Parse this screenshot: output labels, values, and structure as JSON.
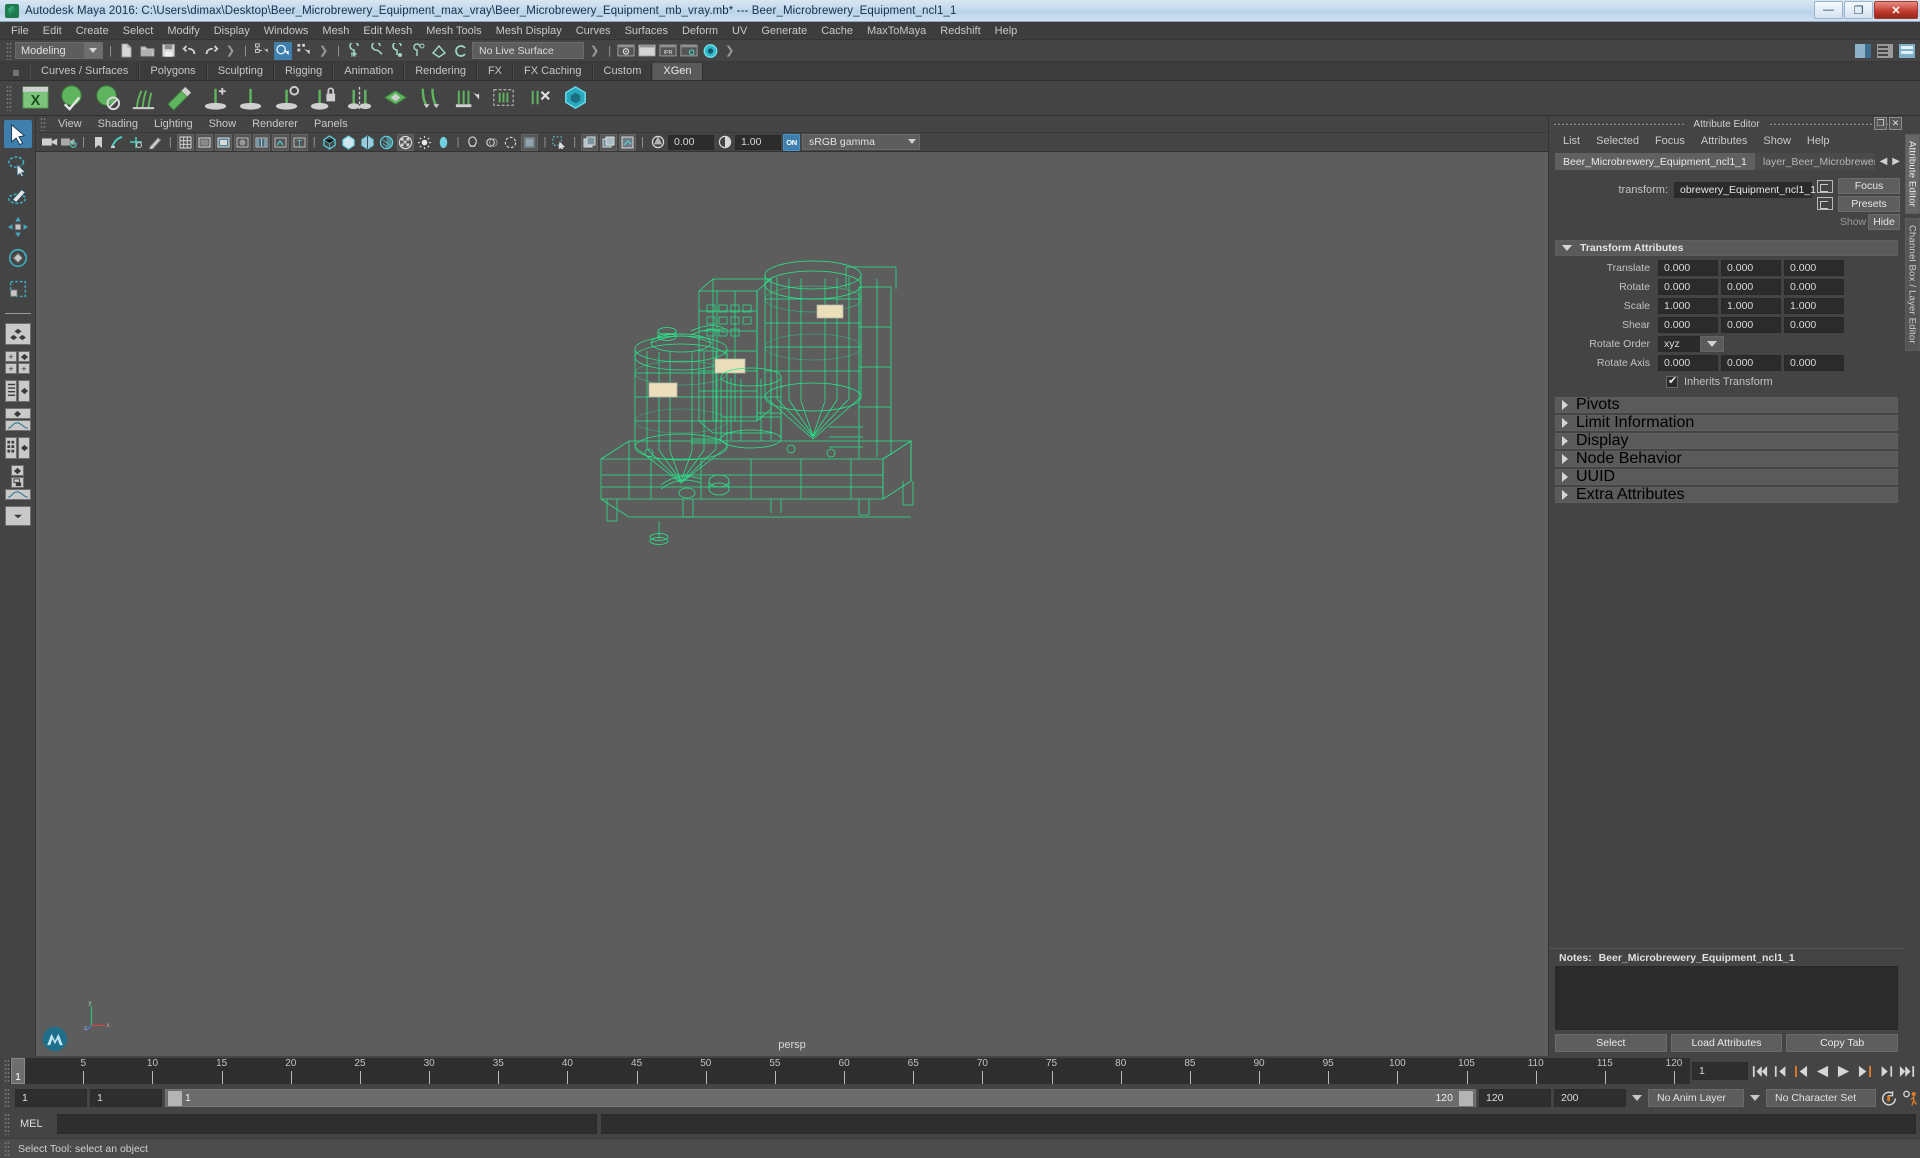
{
  "window": {
    "app_title": "Autodesk Maya 2016: C:\\Users\\dimax\\Desktop\\Beer_Microbrewery_Equipment_max_vray\\Beer_Microbrewery_Equipment_mb_vray.mb*   ---   Beer_Microbrewery_Equipment_ncl1_1",
    "minimize_label": "—",
    "restore_label": "❐",
    "close_label": "✕"
  },
  "main_menu": [
    "File",
    "Edit",
    "Create",
    "Select",
    "Modify",
    "Display",
    "Windows",
    "Mesh",
    "Edit Mesh",
    "Mesh Tools",
    "Mesh Display",
    "Curves",
    "Surfaces",
    "Deform",
    "UV",
    "Generate",
    "Cache",
    "MaxToMaya",
    "Redshift",
    "Help"
  ],
  "status_line": {
    "menuset": "Modeling",
    "live_surface": "No Live Surface"
  },
  "shelf": {
    "tabs": [
      "Curves / Surfaces",
      "Polygons",
      "Sculpting",
      "Rigging",
      "Animation",
      "Rendering",
      "FX",
      "FX Caching",
      "Custom",
      "XGen"
    ],
    "active_tab": "XGen"
  },
  "panel_menu": [
    "View",
    "Shading",
    "Lighting",
    "Show",
    "Renderer",
    "Panels"
  ],
  "viewport": {
    "exposure": "0.00",
    "gamma": "1.00",
    "view_transform": "sRGB gamma",
    "toggle_on_label": "ON",
    "camera_label": "persp",
    "axis_x": "x",
    "axis_y": "y",
    "axis_z": "z"
  },
  "attribute_editor": {
    "panel_title": "Attribute Editor",
    "menu": [
      "List",
      "Selected",
      "Focus",
      "Attributes",
      "Show",
      "Help"
    ],
    "tabs": [
      {
        "label": "Beer_Microbrewery_Equipment_ncl1_1",
        "active": true
      },
      {
        "label": "layer_Beer_Microbrewery_Equ",
        "active": false
      }
    ],
    "node_type_label": "transform:",
    "node_name": "obrewery_Equipment_ncl1_1",
    "focus_label": "Focus",
    "presets_label": "Presets",
    "show_label": "Show",
    "hide_label": "Hide",
    "transform_section": {
      "title": "Transform Attributes",
      "rows": [
        {
          "name": "Translate",
          "values": [
            "0.000",
            "0.000",
            "0.000"
          ]
        },
        {
          "name": "Rotate",
          "values": [
            "0.000",
            "0.000",
            "0.000"
          ]
        },
        {
          "name": "Scale",
          "values": [
            "1.000",
            "1.000",
            "1.000"
          ]
        },
        {
          "name": "Shear",
          "values": [
            "0.000",
            "0.000",
            "0.000"
          ]
        }
      ],
      "rotate_order_label": "Rotate Order",
      "rotate_order_value": "xyz",
      "rotate_axis": {
        "name": "Rotate Axis",
        "values": [
          "0.000",
          "0.000",
          "0.000"
        ]
      },
      "inherits_transform_label": "Inherits Transform",
      "inherits_transform_checked": true
    },
    "collapsed_sections": [
      "Pivots",
      "Limit Information",
      "Display",
      "Node Behavior",
      "UUID",
      "Extra Attributes"
    ],
    "notes_label": "Notes:",
    "notes_node": "Beer_Microbrewery_Equipment_ncl1_1",
    "notes_value": "",
    "buttons": [
      "Select",
      "Load Attributes",
      "Copy Tab"
    ],
    "vertical_tabs": [
      "Attribute Editor",
      "Channel Box / Layer Editor"
    ]
  },
  "timeline": {
    "start": 1,
    "end": 120,
    "current_frame": "1",
    "tick_labels": [
      5,
      10,
      15,
      20,
      25,
      30,
      35,
      40,
      45,
      50,
      55,
      60,
      65,
      70,
      75,
      80,
      85,
      90,
      95,
      100,
      105,
      110,
      115,
      120
    ],
    "cursor_label": "1",
    "current_frame_field": "1"
  },
  "range_slider": {
    "anim_start": "1",
    "range_start": "1",
    "bar_start_label": "1",
    "bar_end_label": "120",
    "range_end": "120",
    "anim_end": "200",
    "anim_layer": "No Anim Layer",
    "character_set": "No Character Set"
  },
  "command_line": {
    "language": "MEL",
    "input_value": "",
    "output_value": ""
  },
  "help_line": {
    "message": "Select Tool: select an object"
  },
  "colors": {
    "wireframe_green": "#24f08e",
    "accent_blue": "#3e7fae",
    "viewport_bg": "#5d5d5d",
    "panel_bg": "#444444",
    "field_bg": "#2b2b2b",
    "playback_orange": "#e07b28"
  }
}
